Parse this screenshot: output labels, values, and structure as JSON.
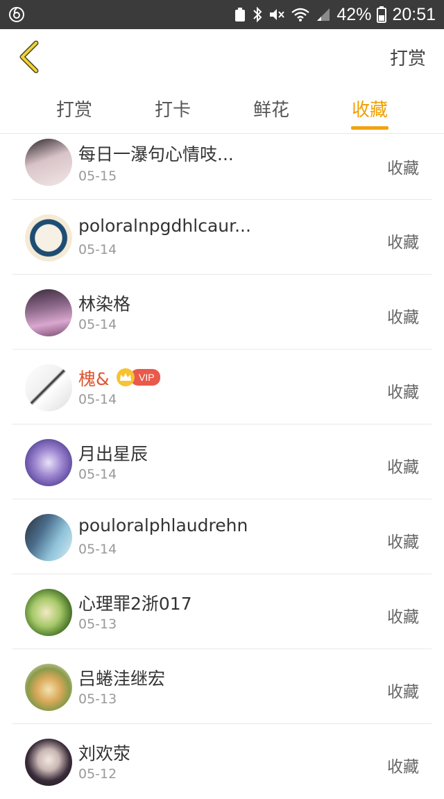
{
  "status_bar": {
    "app_icon": "netease-music-icon",
    "battery_text": "42%",
    "time": "20:51"
  },
  "header": {
    "action_label": "打赏"
  },
  "tabs": [
    {
      "label": "打赏",
      "active": false
    },
    {
      "label": "打卡",
      "active": false
    },
    {
      "label": "鲜花",
      "active": false
    },
    {
      "label": "收藏",
      "active": true
    }
  ],
  "items": [
    {
      "name": "每日一瀑句心情吱...",
      "date": "05-15",
      "action": "收藏",
      "vip": false
    },
    {
      "name": "poloralnpgdhlcaur...",
      "date": "05-14",
      "action": "收藏",
      "vip": false
    },
    {
      "name": "林染格",
      "date": "05-14",
      "action": "收藏",
      "vip": false
    },
    {
      "name": "槐&",
      "date": "05-14",
      "action": "收藏",
      "vip": true,
      "vip_label": "VIP"
    },
    {
      "name": "月出星辰",
      "date": "05-14",
      "action": "收藏",
      "vip": false
    },
    {
      "name": "pouloralphlaudrehn",
      "date": "05-14",
      "action": "收藏",
      "vip": false
    },
    {
      "name": "心理罪2浙017",
      "date": "05-13",
      "action": "收藏",
      "vip": false
    },
    {
      "name": "吕蜷洼继宏",
      "date": "05-13",
      "action": "收藏",
      "vip": false
    },
    {
      "name": "刘欢荥",
      "date": "05-12",
      "action": "收藏",
      "vip": false
    }
  ],
  "colors": {
    "accent": "#f2a30f",
    "vip_name": "#e0532f",
    "vip_badge": "#e95a4b",
    "status_bar": "#3b3b3b"
  }
}
